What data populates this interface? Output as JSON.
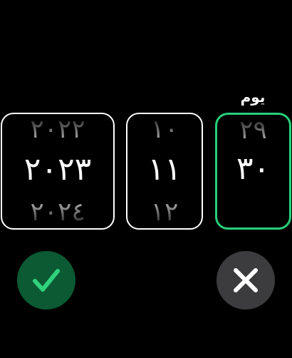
{
  "labels": {
    "day": "يوم"
  },
  "pickers": {
    "year": {
      "prev": "٢٠٢٢",
      "current": "٢٠٢٣",
      "next": "٢٠٢٤"
    },
    "month": {
      "prev": "١٠",
      "current": "١١",
      "next": "١٢"
    },
    "day": {
      "prev": "٢٩",
      "current": "٣٠",
      "next": ""
    }
  },
  "buttons": {
    "confirm": {
      "icon": "checkmark-icon",
      "background": "#0b5a33",
      "icon_color": "#2fd37c"
    },
    "cancel": {
      "icon": "close-icon",
      "background": "#3c3c3e",
      "icon_color": "#ffffff"
    }
  },
  "colors": {
    "accent": "#27d07a",
    "background": "#000000",
    "text": "#ffffff"
  }
}
